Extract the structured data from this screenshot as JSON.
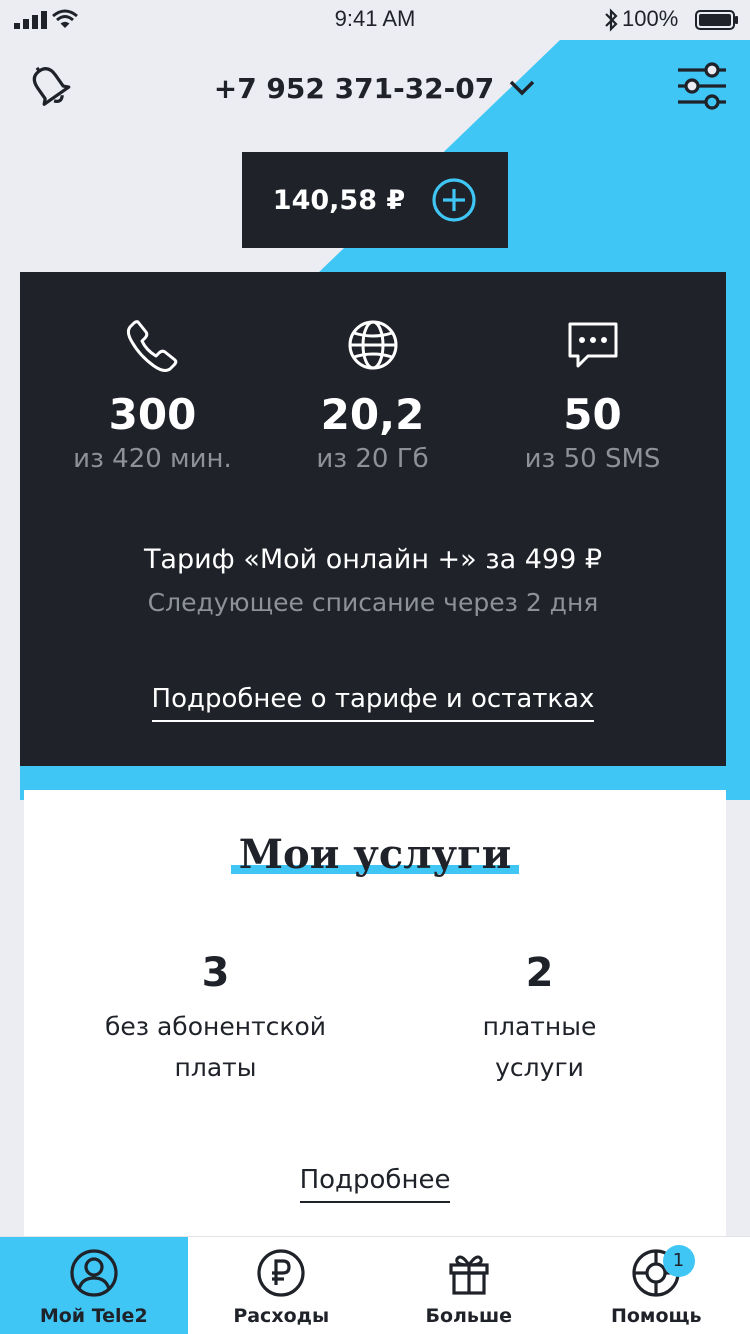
{
  "status_bar": {
    "time": "9:41 AM",
    "battery": "100%"
  },
  "header": {
    "phone_number": "+7 952 371-32-07"
  },
  "balance": {
    "amount": "140,58 ₽"
  },
  "tariff": {
    "counters": [
      {
        "icon": "phone-icon",
        "value": "300",
        "unit": "из 420 мин."
      },
      {
        "icon": "globe-icon",
        "value": "20,2",
        "unit": "из 20 Гб"
      },
      {
        "icon": "sms-icon",
        "value": "50",
        "unit": "из 50 SMS"
      }
    ],
    "name": "Тариф «Мой онлайн +» за 499 ₽",
    "next_charge": "Следующее списание через 2 дня",
    "details_link": "Подробнее о тарифе и остатках"
  },
  "services": {
    "title": "Мои услуги",
    "items": [
      {
        "value": "3",
        "label": "без абонентской\nплаты"
      },
      {
        "value": "2",
        "label": "платные\nуслуги"
      }
    ],
    "details_link": "Подробнее"
  },
  "tabs": [
    {
      "label": "Мой Tele2",
      "icon": "user-icon",
      "active": true
    },
    {
      "label": "Расходы",
      "icon": "ruble-icon",
      "active": false
    },
    {
      "label": "Больше",
      "icon": "gift-icon",
      "active": false
    },
    {
      "label": "Помощь",
      "icon": "lifebuoy-icon",
      "active": false,
      "badge": "1"
    }
  ],
  "colors": {
    "accent": "#3fc6f5",
    "dark": "#1f2229",
    "muted": "#8e9199",
    "background": "#ecedf2"
  }
}
